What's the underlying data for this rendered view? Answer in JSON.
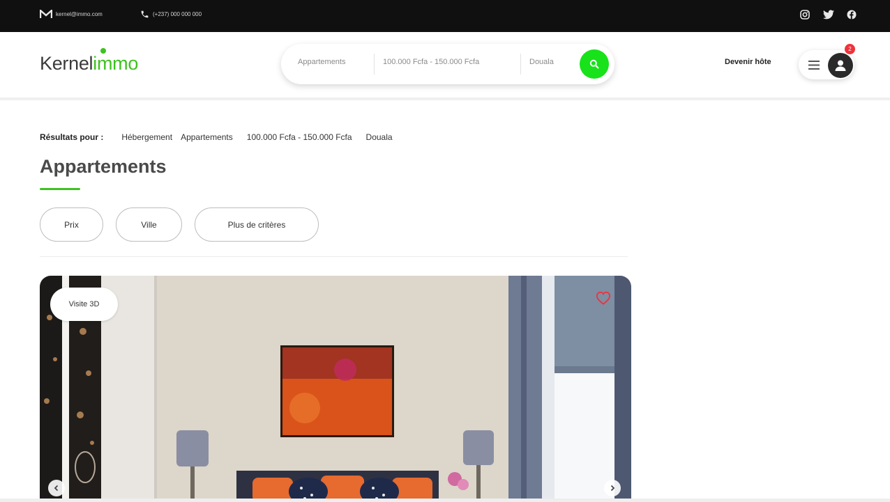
{
  "topbar": {
    "email": "kernel@immo.com",
    "phone": "(+237) 000 000 000",
    "social_icons": [
      "instagram-icon",
      "twitter-icon",
      "facebook-icon"
    ]
  },
  "header": {
    "logo": {
      "part1": "Kernel",
      "part2": "immo"
    },
    "search": {
      "type": "Appartements",
      "price": "100.000 Fcfa - 150.000 Fcfa",
      "city": "Douala",
      "button_icon": "search-icon"
    },
    "host_link": "Devenir hôte",
    "notification_count": "2"
  },
  "results": {
    "label": "Résultats pour :",
    "crumbs": [
      "Hébergement",
      "Appartements",
      "100.000 Fcfa - 150.000 Fcfa",
      "Douala"
    ]
  },
  "page_title": "Appartements",
  "filters": [
    "Prix",
    "Ville",
    "Plus de critères"
  ],
  "listing": {
    "badge": "Visite 3D",
    "favorite_icon": "heart-icon"
  },
  "colors": {
    "accent": "#3ec21f",
    "search_button": "#17e21a",
    "topbar": "#101010",
    "badge": "#f0323b"
  }
}
